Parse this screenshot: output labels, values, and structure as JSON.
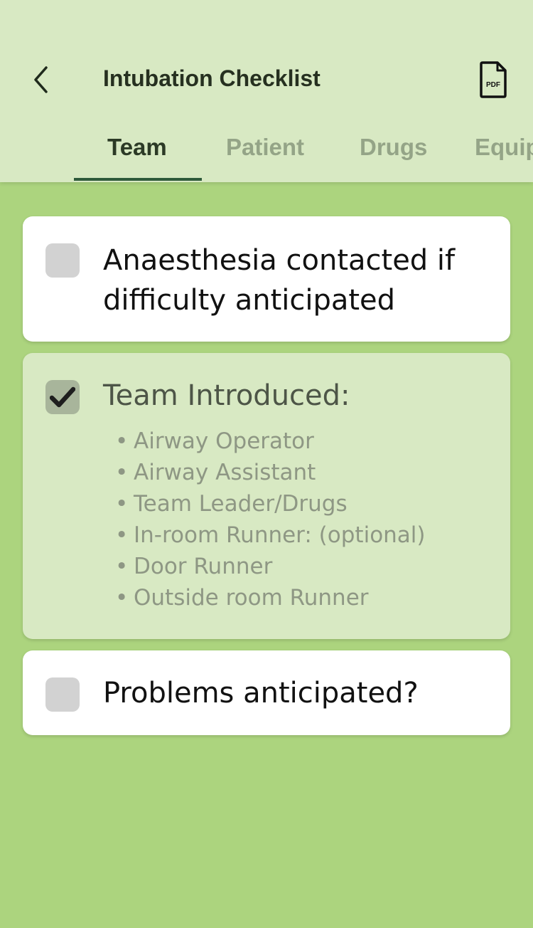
{
  "header": {
    "title": "Intubation Checklist",
    "back_icon": "chevron-left-icon",
    "pdf_icon": "pdf-file-icon",
    "pdf_icon_text": "PDF"
  },
  "tabs": [
    {
      "label": "Team",
      "active": true
    },
    {
      "label": "Patient",
      "active": false
    },
    {
      "label": "Drugs",
      "active": false
    },
    {
      "label": "Equip",
      "active": false
    }
  ],
  "items": [
    {
      "label": "Anaesthesia contacted if difficulty anticipated",
      "checked": false
    },
    {
      "label": "Team Introduced:",
      "checked": true,
      "bullets": [
        "Airway Operator",
        "Airway Assistant",
        "Team Leader/Drugs",
        "In-room Runner: (optional)",
        "Door Runner",
        "Outside room Runner"
      ]
    },
    {
      "label": "Problems anticipated?",
      "checked": false
    }
  ],
  "colors": {
    "background": "#acd47e",
    "header": "#d8e9c3",
    "accent": "#2e5a3a",
    "checked_card": "#d8e9c3"
  }
}
